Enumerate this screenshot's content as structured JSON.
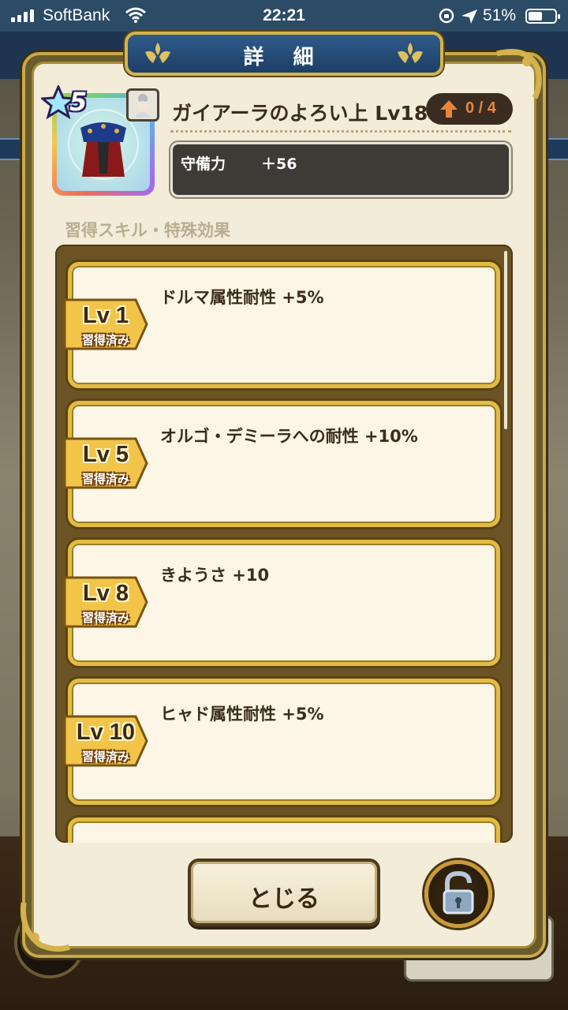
{
  "status_bar": {
    "carrier": "SoftBank",
    "time": "22:21",
    "battery_percent": "51%"
  },
  "modal": {
    "title": "詳 細",
    "item": {
      "rarity_stars": "5",
      "name": "ガイアーラのよろい上 Lv18",
      "upgrade_count": "0 / 4",
      "stats": [
        {
          "label": "守備力",
          "value": "＋56"
        }
      ]
    },
    "section_label": "習得スキル・特殊効果",
    "skills": [
      {
        "level": "Lv 1",
        "status": "習得済み",
        "text": "ドルマ属性耐性 +5%"
      },
      {
        "level": "Lv 5",
        "status": "習得済み",
        "text": "オルゴ・デミーラへの耐性 +10%"
      },
      {
        "level": "Lv 8",
        "status": "習得済み",
        "text": "きようさ +10"
      },
      {
        "level": "Lv 10",
        "status": "習得済み",
        "text": "ヒャド属性耐性 +5%"
      }
    ],
    "close_button_label": "とじる"
  },
  "colors": {
    "gold_frame": "#e3bc43",
    "header_blue": "#2f5b8a",
    "card_bg": "#fbf6e6",
    "text_dark": "#3b2d1c",
    "upgrade_orange": "#e8863a"
  },
  "icons": {
    "item": "armor-icon",
    "character": "character-portrait-icon",
    "upgrade": "up-arrow-icon",
    "lock": "unlocked-padlock-icon"
  }
}
